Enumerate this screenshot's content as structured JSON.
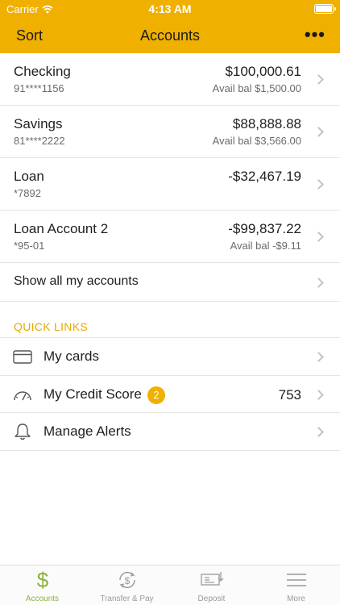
{
  "status_bar": {
    "carrier": "Carrier",
    "time": "4:13 AM"
  },
  "nav": {
    "sort_label": "Sort",
    "title": "Accounts",
    "more_label": "•••"
  },
  "accounts": [
    {
      "name": "Checking",
      "number": "91****1156",
      "amount": "$100,000.61",
      "available": "Avail bal $1,500.00"
    },
    {
      "name": "Savings",
      "number": "81****2222",
      "amount": "$88,888.88",
      "available": "Avail bal $3,566.00"
    },
    {
      "name": "Loan",
      "number": "*7892",
      "amount": "-$32,467.19",
      "available": ""
    },
    {
      "name": "Loan Account 2",
      "number": "*95-01",
      "amount": "-$99,837.22",
      "available": "Avail bal -$9.11"
    }
  ],
  "show_all_label": "Show all my accounts",
  "quick_links": {
    "header": "QUICK LINKS",
    "items": [
      {
        "label": "My cards",
        "icon": "card-icon"
      },
      {
        "label": "My Credit Score",
        "icon": "gauge-icon",
        "badge": "2",
        "value": "753"
      },
      {
        "label": "Manage Alerts",
        "icon": "bell-icon"
      }
    ]
  },
  "tabs": [
    {
      "label": "Accounts",
      "icon": "dollar-icon",
      "active": true
    },
    {
      "label": "Transfer & Pay",
      "icon": "transfer-icon",
      "active": false
    },
    {
      "label": "Deposit",
      "icon": "check-deposit-icon",
      "active": false
    },
    {
      "label": "More",
      "icon": "menu-icon",
      "active": false
    }
  ],
  "colors": {
    "brand": "#F0B000",
    "accent_text": "#E5A800",
    "active_tab": "#8BB03A"
  }
}
